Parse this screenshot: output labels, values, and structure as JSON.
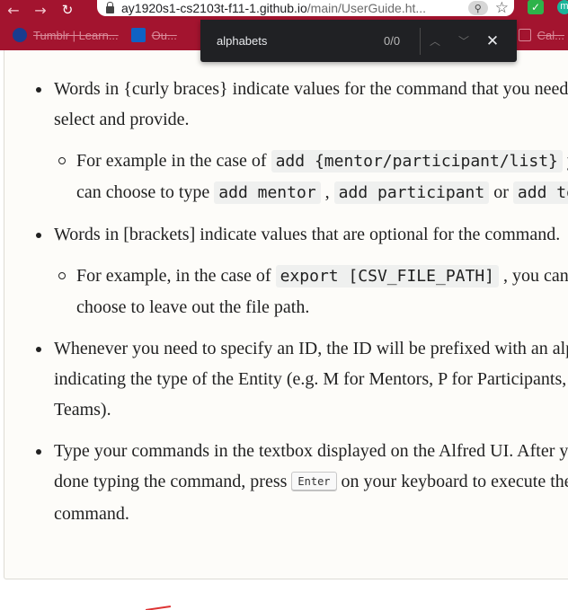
{
  "browser": {
    "url_host": "ay1920s1-cs2103t-f11-1.github.io",
    "url_path": "/main/UserGuide.ht...",
    "extension_badge": "m",
    "bookmarks": [
      {
        "label": "Tumblr | Learn...",
        "icon": "blue-circle-icon"
      },
      {
        "label": "Ou...",
        "icon": "outlook-icon"
      },
      {
        "label": "Cal...",
        "icon": "calendar-icon"
      }
    ]
  },
  "find_bar": {
    "query": "alphabets",
    "count": "0/0"
  },
  "content": {
    "items": [
      {
        "pre": "Words in {curly braces} indicate values for the command that you need to select and provide.",
        "sub": {
          "t1": "For example in the case of ",
          "c1": "add {mentor/participant/list}",
          "t2": " you can choose to type ",
          "c2": "add mentor",
          "t3": " , ",
          "c3": "add participant",
          "t4": " or ",
          "c4": "add team"
        }
      },
      {
        "pre": "Words in [brackets] indicate values that are optional for the command.",
        "sub": {
          "t1": "For example, in the case of ",
          "c1": "export [CSV_FILE_PATH]",
          "t2": " , you can choose to leave out the file path."
        }
      },
      {
        "text": "Whenever you need to specify an ID, the ID will be prefixed with an alphabet indicating the type of the Entity (e.g. M for Mentors, P for Participants, T for Teams)."
      },
      {
        "t1": "Type your commands in the textbox displayed on the Alfred UI. After you are done typing the command, press ",
        "key": "Enter",
        "t2": " on your keyboard to execute the command."
      }
    ]
  }
}
